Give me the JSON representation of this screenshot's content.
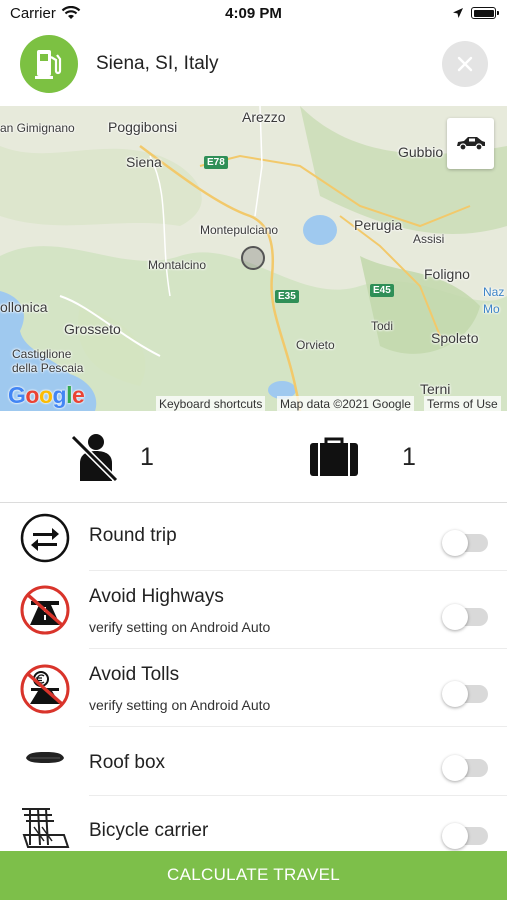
{
  "status_bar": {
    "carrier": "Carrier",
    "time": "4:09 PM"
  },
  "header": {
    "location": "Siena, SI, Italy"
  },
  "map": {
    "places": {
      "san_gimignano": "an Gimignano",
      "poggibonsi": "Poggibonsi",
      "arezzo": "Arezzo",
      "gubbio": "Gubbio",
      "siena": "Siena",
      "montepulciano": "Montepulciano",
      "perugia": "Perugia",
      "assisi": "Assisi",
      "montalcino": "Montalcino",
      "foligno": "Foligno",
      "follonica": "ollonica",
      "grosseto": "Grosseto",
      "todi": "Todi",
      "orvieto": "Orvieto",
      "spoleto": "Spoleto",
      "castiglione": "Castiglione",
      "della_pescaia": "della Pescaia",
      "terni": "Terni",
      "naz": "Naz",
      "mo": "Mo"
    },
    "roads": {
      "e78": "E78",
      "e35": "E35",
      "e45": "E45"
    },
    "logo_letters": [
      "G",
      "o",
      "o",
      "g",
      "l",
      "e"
    ],
    "attribution": {
      "shortcuts": "Keyboard shortcuts",
      "map_data": "Map data ©2021 Google",
      "terms": "Terms of Use"
    }
  },
  "counters": {
    "passengers": "1",
    "luggage": "1"
  },
  "options": [
    {
      "title": "Round trip",
      "subtitle": "",
      "enabled": false
    },
    {
      "title": "Avoid Highways",
      "subtitle": "verify setting on Android Auto",
      "enabled": false
    },
    {
      "title": "Avoid Tolls",
      "subtitle": "verify setting on Android Auto",
      "enabled": false
    },
    {
      "title": "Roof box",
      "subtitle": "",
      "enabled": false
    },
    {
      "title": "Bicycle carrier",
      "subtitle": "",
      "enabled": false
    }
  ],
  "footer": {
    "calculate_label": "CALCULATE TRAVEL"
  },
  "colors": {
    "brand_green": "#7cc142",
    "button_green": "#7dbf4a",
    "prohibition_red": "#d9342b"
  }
}
